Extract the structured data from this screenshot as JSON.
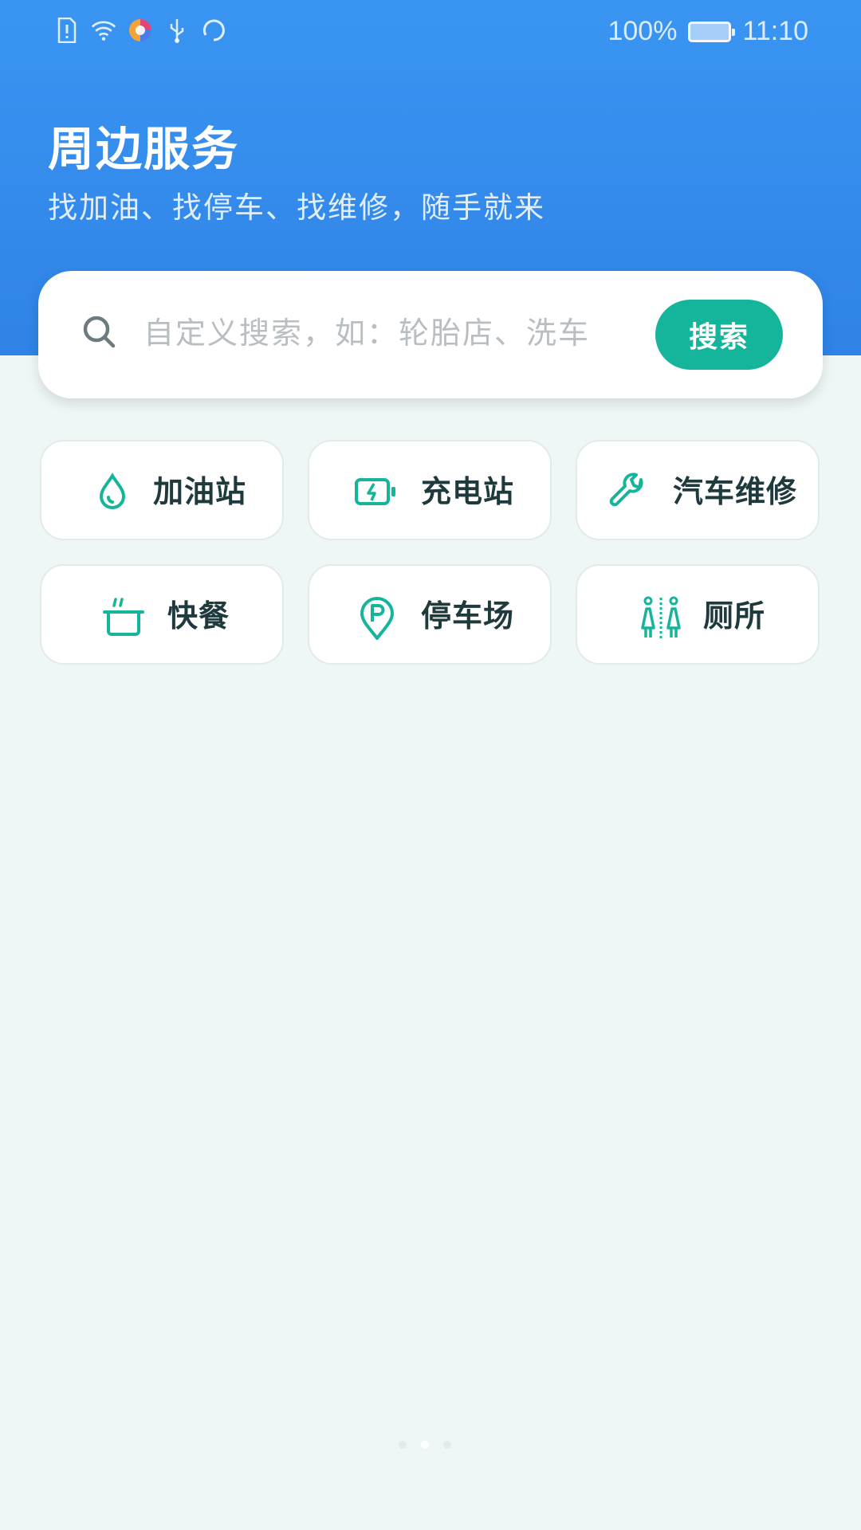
{
  "status_bar": {
    "battery": "100%",
    "time": "11:10",
    "icons": [
      "sim-alert-icon",
      "wifi-icon",
      "browser-icon",
      "usb-icon",
      "sync-icon"
    ]
  },
  "header": {
    "title": "周边服务",
    "subtitle": "找加油、找停车、找维修，随手就来"
  },
  "search": {
    "placeholder": "自定义搜索，如：轮胎店、洗车",
    "button_label": "搜索"
  },
  "services": [
    {
      "label": "加油站",
      "icon": "fuel-drop-icon"
    },
    {
      "label": "充电站",
      "icon": "charging-battery-icon"
    },
    {
      "label": "汽车维修",
      "icon": "wrench-icon"
    },
    {
      "label": "快餐",
      "icon": "food-bowl-icon"
    },
    {
      "label": "停车场",
      "icon": "parking-pin-icon"
    },
    {
      "label": "厕所",
      "icon": "restroom-icon"
    }
  ],
  "colors": {
    "header_blue": "#3a95f2",
    "accent_green": "#14b59a",
    "background": "#eff6f6"
  }
}
